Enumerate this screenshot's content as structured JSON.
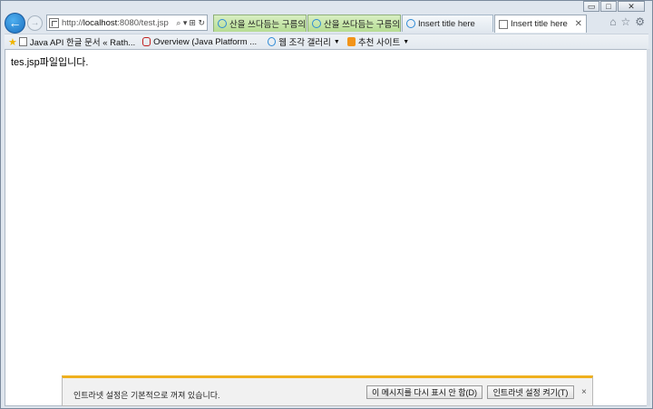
{
  "window": {
    "controls": {
      "minimize": "▭",
      "maximize": "□",
      "close": "✕"
    }
  },
  "nav": {
    "back_icon": "←",
    "forward_icon": "→",
    "address": {
      "prefix": "http://",
      "host": "localhost",
      "path": ":8080/test.jsp",
      "search_icon": "⌕ ▾",
      "action_icons": "⊞ ↻"
    }
  },
  "tabs": [
    {
      "label": "산을 쓰다듬는 구름의 ...",
      "state": "inactive-green",
      "icon": "ie-icon"
    },
    {
      "label": "산을 쓰다듬는 구름의 ...",
      "state": "inactive-green",
      "icon": "ie-icon"
    },
    {
      "label": "Insert title here",
      "state": "inactive",
      "icon": "ie-icon"
    },
    {
      "label": "Insert title here",
      "state": "active",
      "icon": "page-icon",
      "close": "✕"
    }
  ],
  "toolbar_right": {
    "home_icon": "⌂",
    "favorites_icon": "☆",
    "settings_icon": "⚙"
  },
  "favorites": {
    "star_icon": "★",
    "items": [
      {
        "label": "Java API 한글 문서 « Rath...",
        "icon": "page"
      },
      {
        "label": "Overview (Java Platform ...",
        "icon": "oracle"
      },
      {
        "label": "웹 조각 갤러리",
        "icon": "ie",
        "dropdown": "▼"
      },
      {
        "label": "추천 사이트",
        "icon": "orange",
        "dropdown": "▼"
      }
    ]
  },
  "page": {
    "text": "tes.jsp파일입니다."
  },
  "notification": {
    "message": "인트라넷 설정은 기본적으로 꺼져 있습니다.",
    "btn_dont_show": "이 메시지를 다시 표시 안 함(D)",
    "btn_enable": "인트라넷 설정 켜기(T)",
    "close": "×"
  },
  "colors": {
    "accent": "#1b6fc0",
    "tab_green": "#b6dc93",
    "notification_bar": "#efb01e"
  }
}
